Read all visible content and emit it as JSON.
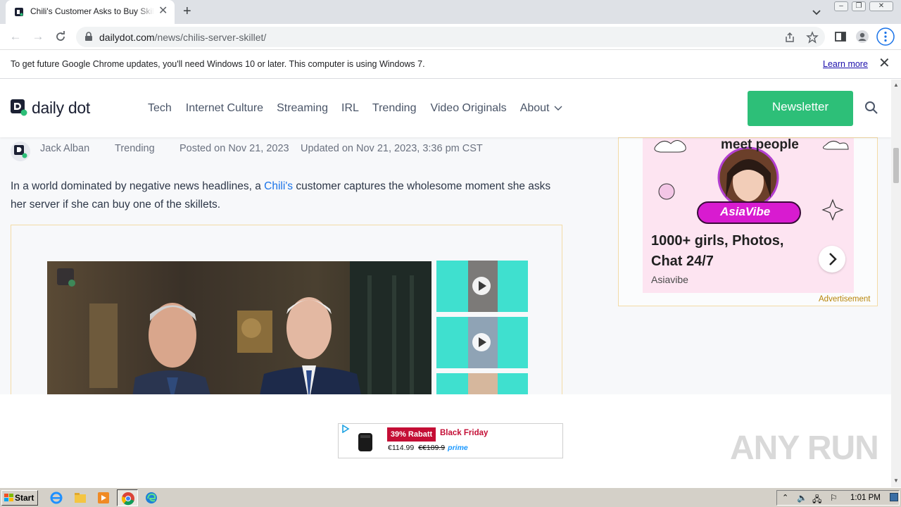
{
  "browser": {
    "tab_title": "Chili's Customer Asks to Buy Skillet A",
    "url_domain": "dailydot.com",
    "url_path": "/news/chilis-server-skillet/",
    "infobar_message": "To get future Google Chrome updates, you'll need Windows 10 or later. This computer is using Windows 7.",
    "infobar_link": "Learn more"
  },
  "site": {
    "logo_text": "daily dot",
    "nav": [
      "Tech",
      "Internet Culture",
      "Streaming",
      "IRL",
      "Trending",
      "Video Originals",
      "About"
    ],
    "newsletter_label": "Newsletter",
    "brand_color": "#2dbf78"
  },
  "article": {
    "author": "Jack Alban",
    "category": "Trending",
    "posted": "Posted on Nov 21, 2023",
    "updated": "Updated on Nov 21, 2023, 3:36 pm CST",
    "lede_before": "In a world dominated by negative news headlines, a ",
    "lede_link": "Chili's",
    "lede_after": " customer captures the wholesome moment she asks her server if she can buy one of the skillets."
  },
  "side_ad": {
    "title": "1000+ girls, Photos, Chat 24/7",
    "brand": "Asiavibe",
    "logo_text": "AsiaVibe",
    "arc_text": "meet people",
    "label": "Advertisement"
  },
  "bottom_ad": {
    "discount": "39% Rabatt",
    "headline": "Black Friday",
    "price": "€114.99",
    "old_price": "€€189.9",
    "prime": "prime"
  },
  "watermark": "ANY RUN",
  "taskbar": {
    "start_label": "Start",
    "clock": "1:01 PM"
  }
}
